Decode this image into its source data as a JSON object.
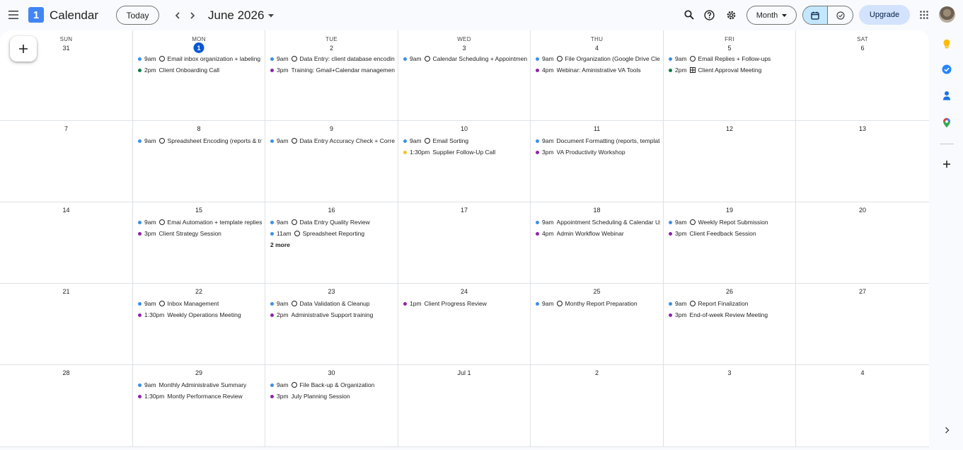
{
  "app": {
    "title": "Calendar",
    "logo_text": "1"
  },
  "header": {
    "today_label": "Today",
    "month_label": "June 2026",
    "view_label": "Month",
    "upgrade_label": "Upgrade"
  },
  "colors": {
    "blue": "#3f8ee8",
    "purple": "#8e24aa",
    "green": "#0b8043",
    "yellow": "#f6bf26",
    "today": "#0b57d0"
  },
  "days_of_week": [
    "SUN",
    "MON",
    "TUE",
    "WED",
    "THU",
    "FRI",
    "SAT"
  ],
  "weeks": [
    {
      "days": [
        {
          "num": "31",
          "events": []
        },
        {
          "num": "1",
          "today": true,
          "events": [
            {
              "color": "blue",
              "time": "9am",
              "task": true,
              "title": "Email inbox organization + labeling system"
            },
            {
              "color": "green",
              "time": "2pm",
              "title": "Client Onboarding Call"
            }
          ]
        },
        {
          "num": "2",
          "events": [
            {
              "color": "blue",
              "time": "9am",
              "task": true,
              "title": "Data Entry: client database encoding"
            },
            {
              "color": "purple",
              "time": "3pm",
              "title": "Training: Gmail+Calendar management"
            }
          ]
        },
        {
          "num": "3",
          "events": [
            {
              "color": "blue",
              "time": "9am",
              "task": true,
              "title": "Calendar Scheduling + Appointment"
            }
          ]
        },
        {
          "num": "4",
          "events": [
            {
              "color": "blue",
              "time": "9am",
              "task": true,
              "title": "File Organization (Google Drive Cleanup)"
            },
            {
              "color": "purple",
              "time": "4pm",
              "title": "Webinar: Aministrative VA Tools"
            }
          ]
        },
        {
          "num": "5",
          "events": [
            {
              "color": "blue",
              "time": "9am",
              "task": true,
              "title": "Email Replies + Follow-ups"
            },
            {
              "color": "green",
              "time": "2pm",
              "grid": true,
              "title": "Client Approval Meeting"
            }
          ]
        },
        {
          "num": "6",
          "events": []
        }
      ]
    },
    {
      "days": [
        {
          "num": "7",
          "events": []
        },
        {
          "num": "8",
          "events": [
            {
              "color": "blue",
              "time": "9am",
              "task": true,
              "title": "Spreadsheet Encoding (reports & tracking)"
            }
          ]
        },
        {
          "num": "9",
          "events": [
            {
              "color": "blue",
              "time": "9am",
              "task": true,
              "title": "Data Entry Accuracy Check + Correction"
            }
          ]
        },
        {
          "num": "10",
          "events": [
            {
              "color": "blue",
              "time": "9am",
              "task": true,
              "title": "Email Sorting"
            },
            {
              "color": "yellow",
              "time": "1:30pm",
              "title": "Supplier Follow-Up Call"
            }
          ]
        },
        {
          "num": "11",
          "events": [
            {
              "color": "blue",
              "time": "9am",
              "title": "Document Formatting (reports, templates)"
            },
            {
              "color": "purple",
              "time": "3pm",
              "title": "VA Productivity Workshop"
            }
          ]
        },
        {
          "num": "12",
          "events": []
        },
        {
          "num": "13",
          "events": []
        }
      ]
    },
    {
      "days": [
        {
          "num": "14",
          "events": []
        },
        {
          "num": "15",
          "events": [
            {
              "color": "blue",
              "time": "9am",
              "task": true,
              "title": "Emai Automation + template replies"
            },
            {
              "color": "purple",
              "time": "3pm",
              "title": "Client Strategy Session"
            }
          ]
        },
        {
          "num": "16",
          "more": "2 more",
          "events": [
            {
              "color": "blue",
              "time": "9am",
              "task": true,
              "title": "Data Entry Quality Review"
            },
            {
              "color": "blue",
              "time": "11am",
              "task": true,
              "title": "Spreadsheet Reporting"
            }
          ]
        },
        {
          "num": "17",
          "events": []
        },
        {
          "num": "18",
          "events": [
            {
              "color": "blue",
              "time": "9am",
              "title": "Appointment Scheduling & Calendar Update"
            },
            {
              "color": "purple",
              "time": "4pm",
              "title": "Admin Workflow Webinar"
            }
          ]
        },
        {
          "num": "19",
          "events": [
            {
              "color": "blue",
              "time": "9am",
              "task": true,
              "title": "Weekly Repot Submission"
            },
            {
              "color": "purple",
              "time": "3pm",
              "title": "Client Feedback Session"
            }
          ]
        },
        {
          "num": "20",
          "events": []
        }
      ]
    },
    {
      "days": [
        {
          "num": "21",
          "events": []
        },
        {
          "num": "22",
          "events": [
            {
              "color": "blue",
              "time": "9am",
              "task": true,
              "title": "Inbox Management"
            },
            {
              "color": "purple",
              "time": "1:30pm",
              "title": "Weekly Operations Meeting"
            }
          ]
        },
        {
          "num": "23",
          "events": [
            {
              "color": "blue",
              "time": "9am",
              "task": true,
              "title": "Data Validation & Cleanup"
            },
            {
              "color": "purple",
              "time": "2pm",
              "title": "Administrative Support training"
            }
          ]
        },
        {
          "num": "24",
          "events": [
            {
              "color": "purple",
              "time": "1pm",
              "title": "Client Progress Review"
            }
          ]
        },
        {
          "num": "25",
          "events": [
            {
              "color": "blue",
              "time": "9am",
              "task": true,
              "title": "Monthy Report Preparation"
            }
          ]
        },
        {
          "num": "26",
          "events": [
            {
              "color": "blue",
              "time": "9am",
              "task": true,
              "title": "Report Finalization"
            },
            {
              "color": "purple",
              "time": "3pm",
              "title": "End-of-week Review Meeting"
            }
          ]
        },
        {
          "num": "27",
          "events": []
        }
      ]
    },
    {
      "days": [
        {
          "num": "28",
          "events": []
        },
        {
          "num": "29",
          "events": [
            {
              "color": "blue",
              "time": "9am",
              "title": "Monthly Administrative Summary"
            },
            {
              "color": "purple",
              "time": "1:30pm",
              "title": "Montly Performance Review"
            }
          ]
        },
        {
          "num": "30",
          "events": [
            {
              "color": "blue",
              "time": "9am",
              "task": true,
              "title": "File Back-up & Organization"
            },
            {
              "color": "purple",
              "time": "3pm",
              "title": "July Planning Session"
            }
          ]
        },
        {
          "num": "Jul 1",
          "events": []
        },
        {
          "num": "2",
          "events": []
        },
        {
          "num": "3",
          "events": []
        },
        {
          "num": "4",
          "events": []
        }
      ]
    }
  ],
  "side_panel": {
    "icons": [
      "keep-icon",
      "tasks-icon",
      "contacts-icon",
      "maps-icon"
    ]
  }
}
